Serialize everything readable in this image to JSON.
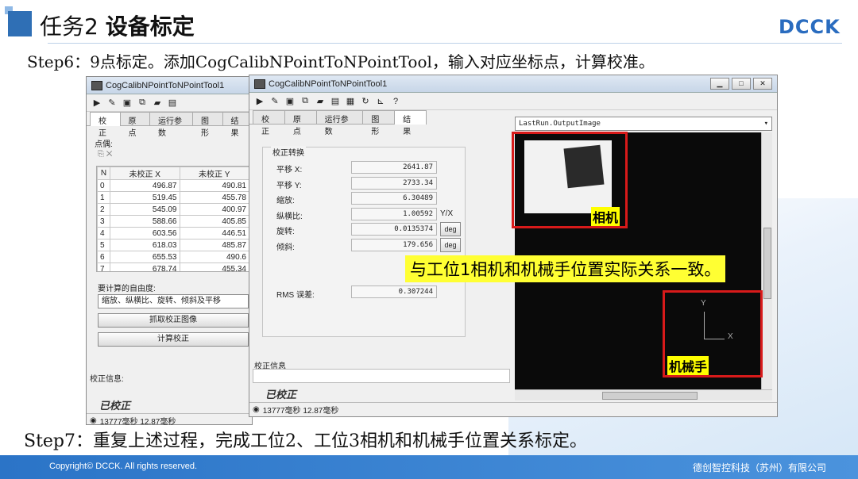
{
  "header": {
    "title_prefix": "任务2",
    "title_main": "设备标定",
    "logo": "DCCK"
  },
  "step6": "Step6：9点标定。添加CogCalibNPointToNPointTool，输入对应坐标点，计算校准。",
  "step7": "Step7：重复上述过程，完成工位2、工位3相机和机械手位置关系标定。",
  "footer": {
    "copyright": "Copyright© DCCK. All rights reserved.",
    "company": "德创智控科技（苏州）有限公司"
  },
  "window_back": {
    "title": "CogCalibNPointToNPointTool1",
    "tabs": [
      "校正",
      "原点",
      "运行参数",
      "图形",
      "结果"
    ],
    "points_label": "点偶:",
    "table_headers": [
      "N",
      "未校正 X",
      "未校正 Y"
    ],
    "rows": [
      [
        "0",
        "496.87",
        "490.81"
      ],
      [
        "1",
        "519.45",
        "455.78"
      ],
      [
        "2",
        "545.09",
        "400.97"
      ],
      [
        "3",
        "588.66",
        "405.85"
      ],
      [
        "4",
        "603.56",
        "446.51"
      ],
      [
        "5",
        "618.03",
        "485.87"
      ],
      [
        "6",
        "655.53",
        "490.6"
      ],
      [
        "7",
        "678.74",
        "455.34"
      ]
    ],
    "dof_label": "要计算的自由度:",
    "dof_value": "缩放、纵横比、旋转、倾斜及平移",
    "grab_button": "抓取校正图像",
    "compute_button": "计算校正",
    "info_label": "校正信息:",
    "calibrated": "已校正",
    "status": "13777毫秒 12.87毫秒"
  },
  "window_front": {
    "title": "CogCalibNPointToNPointTool1",
    "tabs": [
      "校正",
      "原点",
      "运行参数",
      "图形",
      "结果"
    ],
    "active_tab": "结果",
    "group_title": "校正转换",
    "fields": [
      {
        "label": "平移 X:",
        "value": "2641.87",
        "unit": ""
      },
      {
        "label": "平移 Y:",
        "value": "2733.34",
        "unit": ""
      },
      {
        "label": "缩放:",
        "value": "6.30489",
        "unit": ""
      },
      {
        "label": "纵横比:",
        "value": "1.00592",
        "unit": "Y/X"
      },
      {
        "label": "旋转:",
        "value": "0.0135374",
        "unit": "deg"
      },
      {
        "label": "倾斜:",
        "value": "179.656",
        "unit": "deg"
      }
    ],
    "rms_label": "RMS 误差:",
    "rms_value": "0.307244",
    "info_label": "校正信息",
    "calibrated": "已校正",
    "image_select": "LastRun.OutputImage",
    "status": "13777毫秒 12.87毫秒"
  },
  "annotations": {
    "camera": "相机",
    "robot": "机械手",
    "callout": "与工位1相机和机械手位置实际关系一致。",
    "axis_x": "X",
    "axis_y": "Y"
  }
}
